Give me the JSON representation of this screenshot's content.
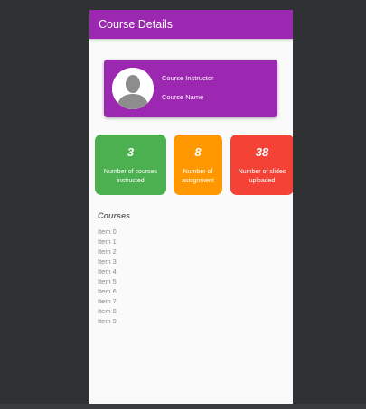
{
  "appbar": {
    "title": "Course Details"
  },
  "profile": {
    "instructor_label": "Course Instructor",
    "course_name_label": "Course Name"
  },
  "stats": [
    {
      "value": "3",
      "label": "Number of courses instructed",
      "color": "#4caf50"
    },
    {
      "value": "8",
      "label": "Number of assignment",
      "color": "#ff9800"
    },
    {
      "value": "38",
      "label": "Number of slides uploaded",
      "color": "#f44336"
    }
  ],
  "courses": {
    "heading": "Courses",
    "items": [
      "Item 0",
      "Item 1",
      "Item 2",
      "Item 3",
      "Item 4",
      "Item 5",
      "Item 6",
      "Item 7",
      "Item 8",
      "Item 9"
    ]
  },
  "colors": {
    "primary": "#9c27b0",
    "background": "#fafafa"
  }
}
